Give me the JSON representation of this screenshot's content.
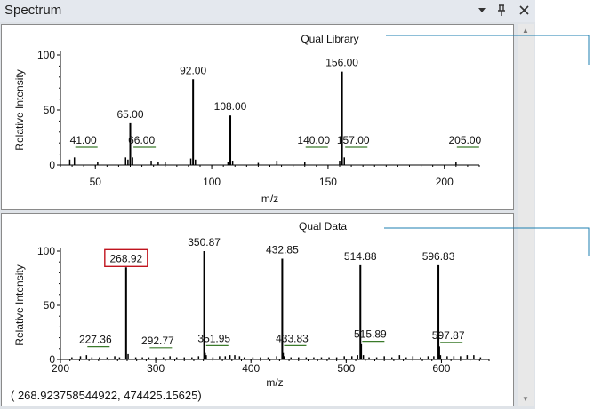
{
  "window": {
    "title": "Spectrum"
  },
  "titlebar_icons": [
    "chevron-down-icon",
    "pin-icon",
    "close-icon"
  ],
  "plots": [
    {
      "label": "Qual Library",
      "ylabel": "Relative Intensity",
      "xlabel": "m/z",
      "xlim": [
        35,
        215
      ],
      "ylim": [
        0,
        100
      ],
      "xticks": [
        "50",
        "100",
        "150",
        "200"
      ],
      "yticks": [
        "0",
        "50",
        "100"
      ],
      "chart_data": {
        "type": "bar",
        "peaks": [
          {
            "x": 92.0,
            "y": 78,
            "label": "92.00"
          },
          {
            "x": 156.0,
            "y": 85,
            "label": "156.00"
          },
          {
            "x": 108.0,
            "y": 45,
            "label": "108.00"
          },
          {
            "x": 65.0,
            "y": 38,
            "label": "65.00"
          },
          {
            "x": 41.0,
            "y": 7,
            "label": "41.00"
          },
          {
            "x": 66.0,
            "y": 7,
            "label": "66.00"
          },
          {
            "x": 140.0,
            "y": 3,
            "label": "140.00"
          },
          {
            "x": 157.0,
            "y": 7,
            "label": "157.00"
          },
          {
            "x": 205.0,
            "y": 3,
            "label": "205.00"
          },
          {
            "x": 39.0,
            "y": 5
          },
          {
            "x": 51.0,
            "y": 3
          },
          {
            "x": 63.0,
            "y": 7
          },
          {
            "x": 64.0,
            "y": 5
          },
          {
            "x": 74.0,
            "y": 4
          },
          {
            "x": 77.0,
            "y": 3
          },
          {
            "x": 80.0,
            "y": 3
          },
          {
            "x": 91.0,
            "y": 6
          },
          {
            "x": 93.0,
            "y": 5
          },
          {
            "x": 107.0,
            "y": 3
          },
          {
            "x": 109.0,
            "y": 4
          },
          {
            "x": 120.0,
            "y": 2
          },
          {
            "x": 128.0,
            "y": 4
          },
          {
            "x": 155.0,
            "y": 4
          }
        ]
      }
    },
    {
      "label": "Qual Data",
      "ylabel": "Relative Intensity",
      "xlabel": "m/z",
      "xlim": [
        200,
        650
      ],
      "ylim": [
        0,
        100
      ],
      "xticks": [
        "200",
        "300",
        "400",
        "500",
        "600"
      ],
      "yticks": [
        "0",
        "50",
        "100"
      ],
      "coordinate_readout": "( 268.923758544922, 474425.15625)",
      "highlighted_peak": "268.92",
      "chart_data": {
        "type": "bar",
        "peaks": [
          {
            "x": 268.92,
            "y": 85,
            "label": "268.92"
          },
          {
            "x": 350.87,
            "y": 100,
            "label": "350.87"
          },
          {
            "x": 432.85,
            "y": 93,
            "label": "432.85"
          },
          {
            "x": 514.88,
            "y": 87,
            "label": "514.88"
          },
          {
            "x": 596.83,
            "y": 87,
            "label": "596.83"
          },
          {
            "x": 227.36,
            "y": 4,
            "label": "227.36"
          },
          {
            "x": 292.77,
            "y": 2,
            "label": "292.77"
          },
          {
            "x": 351.95,
            "y": 6,
            "label": "351.95"
          },
          {
            "x": 433.83,
            "y": 6,
            "label": "433.83"
          },
          {
            "x": 515.89,
            "y": 14,
            "label": "515.89"
          },
          {
            "x": 597.87,
            "y": 12,
            "label": "597.87"
          },
          {
            "x": 212,
            "y": 2
          },
          {
            "x": 221,
            "y": 3
          },
          {
            "x": 233,
            "y": 2
          },
          {
            "x": 241,
            "y": 2
          },
          {
            "x": 249,
            "y": 2
          },
          {
            "x": 257,
            "y": 3
          },
          {
            "x": 262,
            "y": 2
          },
          {
            "x": 271,
            "y": 5
          },
          {
            "x": 279,
            "y": 2
          },
          {
            "x": 286,
            "y": 2
          },
          {
            "x": 300,
            "y": 2
          },
          {
            "x": 308,
            "y": 2
          },
          {
            "x": 315,
            "y": 3
          },
          {
            "x": 322,
            "y": 2
          },
          {
            "x": 330,
            "y": 2
          },
          {
            "x": 338,
            "y": 2
          },
          {
            "x": 345,
            "y": 3
          },
          {
            "x": 353,
            "y": 4
          },
          {
            "x": 360,
            "y": 2
          },
          {
            "x": 367,
            "y": 3
          },
          {
            "x": 373,
            "y": 3
          },
          {
            "x": 378,
            "y": 4
          },
          {
            "x": 383,
            "y": 4
          },
          {
            "x": 388,
            "y": 3
          },
          {
            "x": 393,
            "y": 2
          },
          {
            "x": 402,
            "y": 2
          },
          {
            "x": 410,
            "y": 2
          },
          {
            "x": 418,
            "y": 2
          },
          {
            "x": 427,
            "y": 3
          },
          {
            "x": 435,
            "y": 3
          },
          {
            "x": 442,
            "y": 2
          },
          {
            "x": 450,
            "y": 2
          },
          {
            "x": 458,
            "y": 2
          },
          {
            "x": 466,
            "y": 2
          },
          {
            "x": 474,
            "y": 2
          },
          {
            "x": 482,
            "y": 2
          },
          {
            "x": 490,
            "y": 2
          },
          {
            "x": 498,
            "y": 3
          },
          {
            "x": 506,
            "y": 3
          },
          {
            "x": 512,
            "y": 4
          },
          {
            "x": 518,
            "y": 4
          },
          {
            "x": 524,
            "y": 2
          },
          {
            "x": 532,
            "y": 2
          },
          {
            "x": 540,
            "y": 3
          },
          {
            "x": 548,
            "y": 2
          },
          {
            "x": 556,
            "y": 4
          },
          {
            "x": 563,
            "y": 2
          },
          {
            "x": 570,
            "y": 3
          },
          {
            "x": 578,
            "y": 2
          },
          {
            "x": 586,
            "y": 3
          },
          {
            "x": 592,
            "y": 3
          },
          {
            "x": 599,
            "y": 4
          },
          {
            "x": 606,
            "y": 3
          },
          {
            "x": 613,
            "y": 3
          },
          {
            "x": 620,
            "y": 3
          },
          {
            "x": 627,
            "y": 4
          },
          {
            "x": 634,
            "y": 4
          },
          {
            "x": 641,
            "y": 2
          }
        ]
      }
    }
  ],
  "colors": {
    "panel_bg": "#dfe3e8",
    "plot_border": "#8a8a8a",
    "label_underline": "#3a7a2a",
    "highlight_box": "#c0141e",
    "callout_line": "#1e7fb0"
  }
}
